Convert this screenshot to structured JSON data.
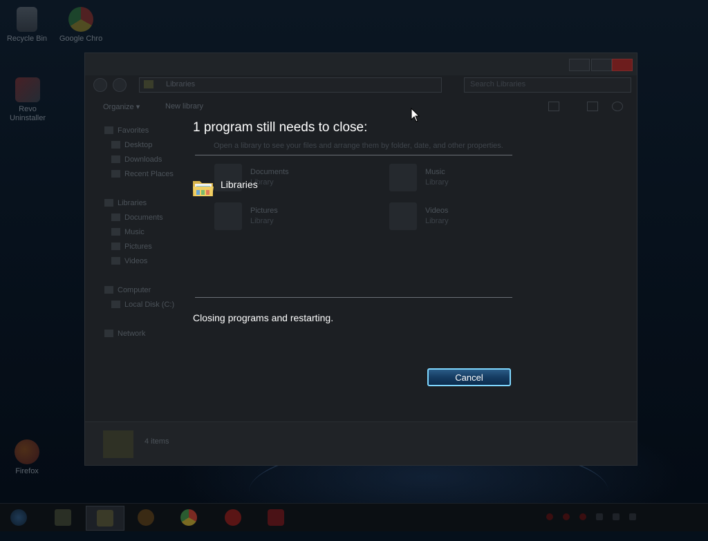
{
  "desktop": {
    "icons": [
      {
        "label": "Recycle Bin",
        "icon": "recycle-bin-icon"
      },
      {
        "label": "Google Chro",
        "icon": "chrome-icon"
      },
      {
        "label": "Revo Uninstaller",
        "icon": "revo-uninstaller-icon"
      },
      {
        "label": "Firefox",
        "icon": "firefox-icon"
      }
    ]
  },
  "explorer": {
    "address": "Libraries",
    "search_placeholder": "Search Libraries",
    "toolbar": {
      "organize": "Organize ▾",
      "new_library": "New library"
    },
    "hint": "Open a library to see your files and arrange them by folder, date, and other properties.",
    "nav": {
      "favorites": "Favorites",
      "desktop": "Desktop",
      "downloads": "Downloads",
      "recent": "Recent Places",
      "libraries": "Libraries",
      "documents": "Documents",
      "music": "Music",
      "pictures": "Pictures",
      "videos": "Videos",
      "computer": "Computer",
      "local_disk": "Local Disk (C:)",
      "network": "Network"
    },
    "items": [
      {
        "name": "Documents",
        "type": "Library"
      },
      {
        "name": "Music",
        "type": "Library"
      },
      {
        "name": "Pictures",
        "type": "Library"
      },
      {
        "name": "Videos",
        "type": "Library"
      }
    ],
    "status": "4 items"
  },
  "restart_dialog": {
    "title": "1 program still needs to close:",
    "program": {
      "name": "Libraries",
      "icon": "libraries-folder-icon"
    },
    "status": "Closing programs and restarting.",
    "cancel_label": "Cancel"
  },
  "taskbar": {
    "items": [
      "start-orb-icon",
      "explorer-icon",
      "libraries-icon",
      "media-player-icon",
      "chrome-icon",
      "record-icon",
      "screen-recorder-icon"
    ]
  },
  "colors": {
    "button_border": "#7fd7ff",
    "button_fill": "#153c62",
    "overlay_text": "#ffffff"
  }
}
